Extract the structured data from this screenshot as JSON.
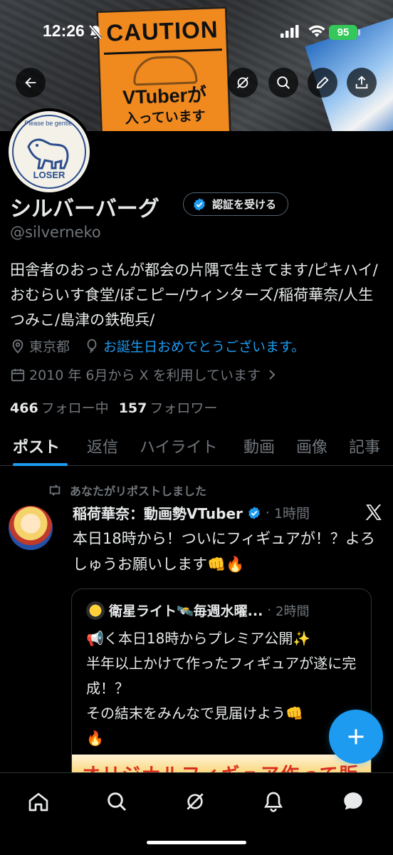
{
  "status_bar": {
    "time": "12:26",
    "battery": "95"
  },
  "banner": {
    "sign_top": "CAUTION",
    "sign_main": "VTuberが",
    "sign_sub": "入っています"
  },
  "header_icons": [
    "back-arrow-icon",
    "grok-icon",
    "search-icon",
    "edit-icon",
    "share-icon"
  ],
  "avatar": {
    "top_text": "Please be gentle.",
    "bottom_text": "LOSER"
  },
  "profile": {
    "display_name": "シルバーバーグ",
    "verify_label": "認証を受ける",
    "handle": "@silverneko",
    "bio": "田舎者のおっさんが都会の片隅で生きてます/ピキハイ/おむらいす食堂/ぽこピー/ウィンターズ/稲荷華奈/人生つみこ/島津の鉄砲兵/",
    "location": "東京都",
    "birthday": "お誕生日おめでとうございます。",
    "joined": "2010 年 6月から X を利用しています",
    "following_count": "466",
    "following_label": "フォロー中",
    "followers_count": "157",
    "followers_label": "フォロワー"
  },
  "tabs": [
    "ポスト",
    "返信",
    "ハイライト",
    "動画",
    "画像",
    "記事"
  ],
  "active_tab": "ポスト",
  "post": {
    "repost_label": "あなたがリポストしました",
    "author": "稲荷華奈：動画勢VTuber",
    "dot": "·",
    "time": "1時間",
    "text": "本日18時から！ついにフィギュアが！？よろしゅうお願いします👊🔥",
    "quote": {
      "author": "衛星ライト🛰️毎週水曜...",
      "dot": "·",
      "time": "2時間",
      "text": "📢く本日18時からプレミア公開✨\n半年以上かけて作ったフィギュアが遂に完成！？\nその結末をみんなで見届けよう👊\n🔥",
      "image_text": "オリジナルフィギュア作って販売！"
    }
  },
  "bottom_nav": [
    "home-icon",
    "search-icon",
    "grok-icon",
    "notifications-icon",
    "messages-icon"
  ],
  "colors": {
    "accent": "#1d9bf0",
    "text": "#e7e9ea",
    "muted": "#71767b",
    "background": "#000000",
    "border": "#2f3336"
  }
}
